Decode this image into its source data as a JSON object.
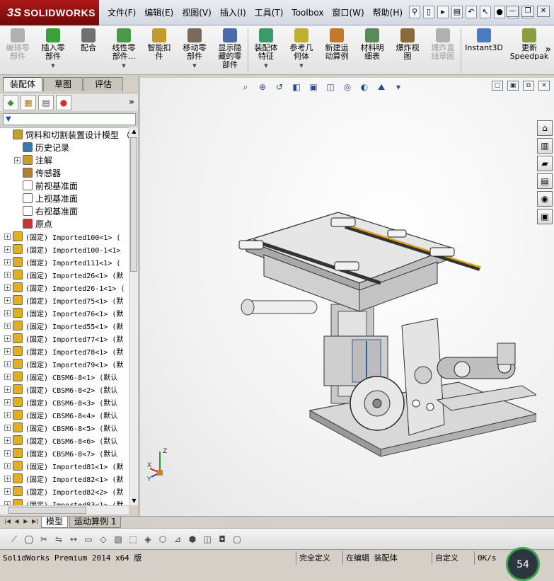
{
  "app": {
    "logo": "SOLIDWORKS",
    "logo_prefix": "3S"
  },
  "menu": [
    "文件(F)",
    "编辑(E)",
    "视图(V)",
    "插入(I)",
    "工具(T)",
    "Toolbox",
    "窗口(W)",
    "帮助(H)"
  ],
  "quick_access": [
    "pin-icon",
    "new-icon",
    "open-icon",
    "print-icon",
    "undo-icon",
    "select-icon",
    "rebuild-icon",
    "options-icon",
    "help-icon"
  ],
  "window_controls": [
    "minimize",
    "restore",
    "close"
  ],
  "ribbon": [
    {
      "label": "编辑零\n部件",
      "disabled": true,
      "color": "#b0b0b0"
    },
    {
      "label": "插入零\n部件",
      "disabled": false,
      "color": "#3aa03a",
      "caret": true
    },
    {
      "label": "配合",
      "disabled": false,
      "color": "#707070"
    },
    {
      "label": "线性零\n部件...",
      "disabled": false,
      "color": "#4a9a4a",
      "caret": true
    },
    {
      "label": "智能扣\n件",
      "disabled": false,
      "color": "#c49a2a"
    },
    {
      "label": "移动零\n部件",
      "disabled": false,
      "color": "#7a6a5a",
      "caret": true
    },
    {
      "label": "显示隐\n藏的零\n部件",
      "disabled": false,
      "color": "#4a6aaa"
    },
    {
      "label": "装配体\n特征",
      "disabled": false,
      "color": "#3a9a6a",
      "caret": true
    },
    {
      "label": "参考几\n何体",
      "disabled": false,
      "color": "#c0b030",
      "caret": true
    },
    {
      "label": "新建运\n动算例",
      "disabled": false,
      "color": "#c07a2a"
    },
    {
      "label": "材料明\n细表",
      "disabled": false,
      "color": "#5a8a5a"
    },
    {
      "label": "爆炸视\n图",
      "disabled": false,
      "color": "#8a6a3a"
    },
    {
      "label": "爆炸直\n线草图",
      "disabled": true,
      "color": "#b0b0b0"
    },
    {
      "label": "Instant3D",
      "disabled": false,
      "color": "#4a7ac0"
    },
    {
      "label": "更新\nSpeedpak",
      "disabled": false,
      "color": "#8aa040"
    }
  ],
  "left_tabs": [
    "装配体",
    "草图",
    "评估"
  ],
  "panel_icons": [
    "feature-manager-icon",
    "property-manager-icon",
    "configuration-manager-icon",
    "display-manager-icon"
  ],
  "filter": "▼",
  "tree": [
    {
      "label": "饲料和切割装置设计模型 （",
      "indent": 0,
      "exp": "",
      "icon": "#c8a020",
      "mono": false
    },
    {
      "label": "历史记录",
      "indent": 1,
      "exp": "",
      "icon": "#3a7ab0",
      "mono": false
    },
    {
      "label": "注解",
      "indent": 1,
      "exp": "+",
      "icon": "#c8a020",
      "mono": false
    },
    {
      "label": "传感器",
      "indent": 1,
      "exp": "",
      "icon": "#b08030",
      "mono": false
    },
    {
      "label": "前视基准面",
      "indent": 1,
      "exp": "",
      "icon": "#ffffff",
      "mono": false
    },
    {
      "label": "上视基准面",
      "indent": 1,
      "exp": "",
      "icon": "#ffffff",
      "mono": false
    },
    {
      "label": "右视基准面",
      "indent": 1,
      "exp": "",
      "icon": "#ffffff",
      "mono": false
    },
    {
      "label": "原点",
      "indent": 1,
      "exp": "",
      "icon": "#cc3333",
      "mono": false
    },
    {
      "label": "(固定) Imported100<1> (",
      "indent": 0,
      "exp": "+",
      "icon": "#e0b020",
      "mono": true
    },
    {
      "label": "(固定) Imported100-1<1>",
      "indent": 0,
      "exp": "+",
      "icon": "#e0b020",
      "mono": true
    },
    {
      "label": "(固定) Imported111<1> (",
      "indent": 0,
      "exp": "+",
      "icon": "#e0b020",
      "mono": true
    },
    {
      "label": "(固定) Imported26<1> (默",
      "indent": 0,
      "exp": "+",
      "icon": "#e0b020",
      "mono": true
    },
    {
      "label": "(固定) Imported26-1<1> (",
      "indent": 0,
      "exp": "+",
      "icon": "#e0b020",
      "mono": true
    },
    {
      "label": "(固定) Imported75<1> (默",
      "indent": 0,
      "exp": "+",
      "icon": "#e0b020",
      "mono": true
    },
    {
      "label": "(固定) Imported76<1> (默",
      "indent": 0,
      "exp": "+",
      "icon": "#e0b020",
      "mono": true
    },
    {
      "label": "(固定) Imported55<1> (默",
      "indent": 0,
      "exp": "+",
      "icon": "#e0b020",
      "mono": true
    },
    {
      "label": "(固定) Imported77<1> (默",
      "indent": 0,
      "exp": "+",
      "icon": "#e0b020",
      "mono": true
    },
    {
      "label": "(固定) Imported78<1> (默",
      "indent": 0,
      "exp": "+",
      "icon": "#e0b020",
      "mono": true
    },
    {
      "label": "(固定) Imported79<1> (默",
      "indent": 0,
      "exp": "+",
      "icon": "#e0b020",
      "mono": true
    },
    {
      "label": "(固定) CBSM6-8<1> (默认",
      "indent": 0,
      "exp": "+",
      "icon": "#e0b020",
      "mono": true
    },
    {
      "label": "(固定) CBSM6-8<2> (默认",
      "indent": 0,
      "exp": "+",
      "icon": "#e0b020",
      "mono": true
    },
    {
      "label": "(固定) CBSM6-8<3> (默认",
      "indent": 0,
      "exp": "+",
      "icon": "#e0b020",
      "mono": true
    },
    {
      "label": "(固定) CBSM6-8<4> (默认",
      "indent": 0,
      "exp": "+",
      "icon": "#e0b020",
      "mono": true
    },
    {
      "label": "(固定) CBSM6-8<5> (默认",
      "indent": 0,
      "exp": "+",
      "icon": "#e0b020",
      "mono": true
    },
    {
      "label": "(固定) CBSM6-8<6> (默认",
      "indent": 0,
      "exp": "+",
      "icon": "#e0b020",
      "mono": true
    },
    {
      "label": "(固定) CBSM6-8<7> (默认",
      "indent": 0,
      "exp": "+",
      "icon": "#e0b020",
      "mono": true
    },
    {
      "label": "(固定) Imported81<1> (默",
      "indent": 0,
      "exp": "+",
      "icon": "#e0b020",
      "mono": true
    },
    {
      "label": "(固定) Imported82<1> (默",
      "indent": 0,
      "exp": "+",
      "icon": "#e0b020",
      "mono": true
    },
    {
      "label": "(固定) Imported82<2> (默",
      "indent": 0,
      "exp": "+",
      "icon": "#e0b020",
      "mono": true
    },
    {
      "label": "(固定) Imported83<1> (默",
      "indent": 0,
      "exp": "+",
      "icon": "#e0b020",
      "mono": true
    }
  ],
  "headsup": [
    "zoom-to-fit-icon",
    "zoom-area-icon",
    "previous-view-icon",
    "section-view-icon",
    "view-orientation-icon",
    "display-style-icon",
    "hide-show-icon",
    "edit-appearance-icon",
    "apply-scene-icon",
    "view-settings-icon"
  ],
  "viewport_controls": [
    "▢",
    "▣",
    "⧉",
    "✕"
  ],
  "task_pane": [
    "home-icon",
    "design-library-icon",
    "file-explorer-icon",
    "view-palette-icon",
    "appearances-icon",
    "custom-properties-icon"
  ],
  "triad": {
    "x": "X",
    "y": "Y",
    "z": "Z"
  },
  "bottom_tabs": [
    "模型",
    "运动算例 1"
  ],
  "bottom_tools": [
    "line-icon",
    "circle-icon",
    "trim-icon",
    "mirror-icon",
    "smart-dim-icon",
    "rect-icon",
    "plane-icon",
    "cube-icon"
  ],
  "status": {
    "version": "SolidWorks Premium 2014 x64 版",
    "defined": "完全定义",
    "editing": "在编辑 装配体",
    "custom": "自定义",
    "speed": "0K/s",
    "gauge": "54"
  }
}
